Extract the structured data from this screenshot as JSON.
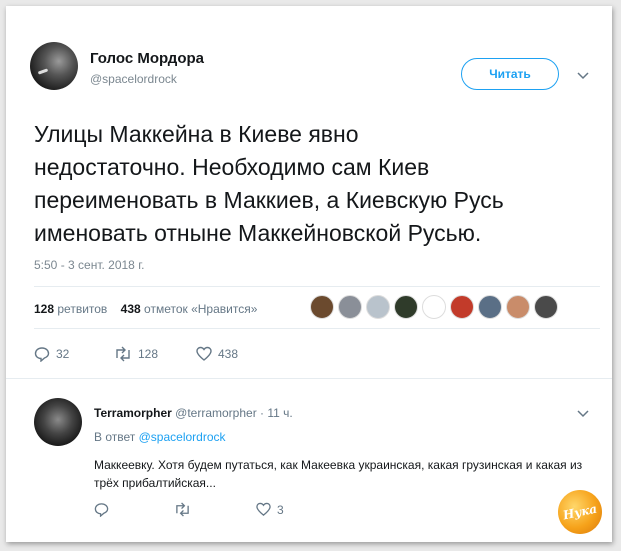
{
  "tweet": {
    "display_name": "Голос Мордора",
    "handle": "@spacelordrock",
    "follow_label": "Читать",
    "text": "Улицы Маккейна в Киеве явно\nнедостаточно. Необходимо сам Киев\nпереименовать в Маккиев, а Киевскую Русь\nименовать отныне Маккейновской Русью.",
    "timestamp": "5:50 - 3 сент. 2018 г.",
    "retweets_count": "128",
    "retweets_label": "ретвитов",
    "likes_count": "438",
    "likes_label": "отметок «Нравится»",
    "likers": [
      {
        "icon": "avatar-liker-1",
        "color": "#6b4a2e"
      },
      {
        "icon": "avatar-liker-2",
        "color": "#8a8f98"
      },
      {
        "icon": "avatar-liker-3",
        "color": "#b9c3cc"
      },
      {
        "icon": "avatar-liker-4",
        "color": "#2f3b2a"
      },
      {
        "icon": "avatar-liker-5",
        "color": "#ffffff"
      },
      {
        "icon": "avatar-liker-6",
        "color": "#c23b2a"
      },
      {
        "icon": "avatar-liker-7",
        "color": "#5a6f86"
      },
      {
        "icon": "avatar-liker-8",
        "color": "#c98c6a"
      },
      {
        "icon": "avatar-liker-9",
        "color": "#4a4a4a"
      }
    ],
    "actions": {
      "replies": "32",
      "retweets": "128",
      "likes": "438"
    }
  },
  "reply": {
    "name": "Terramorpher",
    "handle": "@terramorpher",
    "time": "· 11 ч.",
    "in_reply_prefix": "В ответ",
    "in_reply_handle": "@spacelordrock",
    "text": "Маккеевку. Хотя будем путаться, как Макеевка украинская, какая грузинская и какая из трёх прибалтийская...",
    "actions": {
      "replies": "",
      "retweets": "",
      "likes": "3"
    }
  },
  "watermark": {
    "text": "Нука"
  },
  "colors": {
    "accent": "#1da1f2",
    "text": "#14171a",
    "muted": "#657786"
  }
}
